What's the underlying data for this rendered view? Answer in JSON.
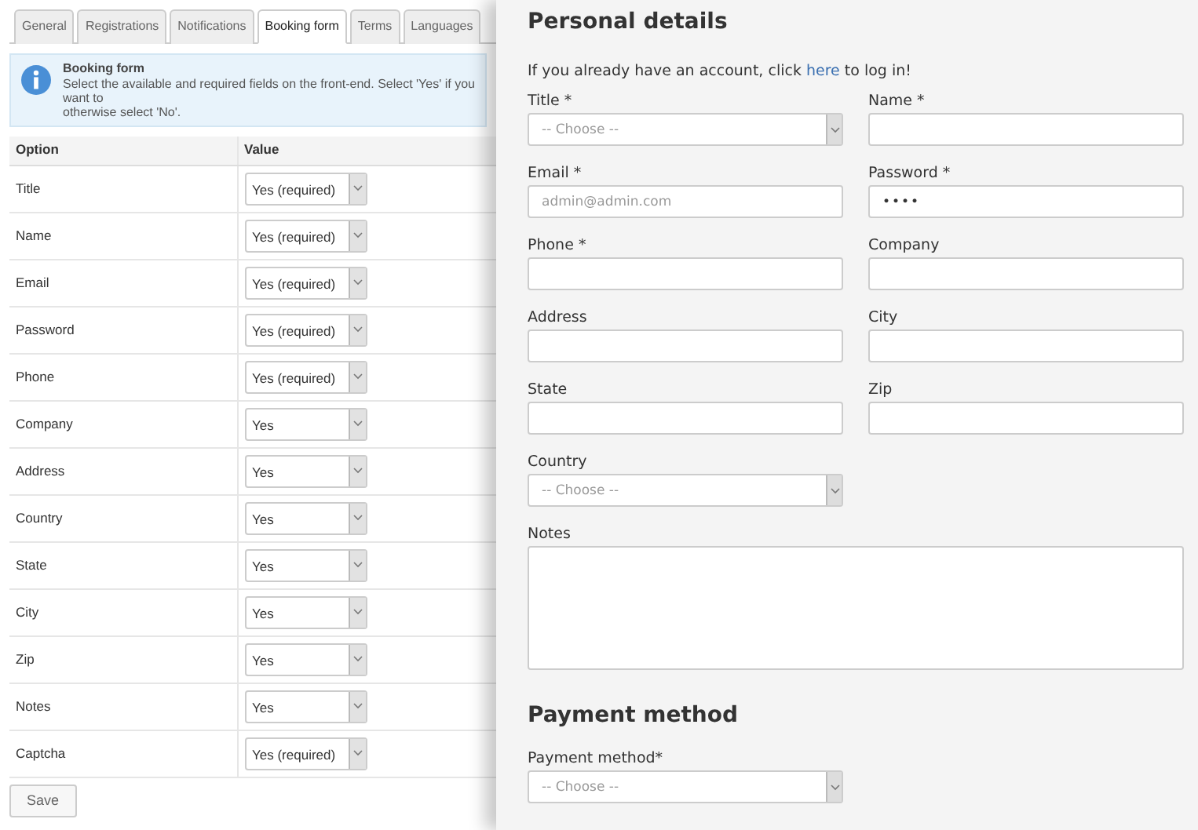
{
  "tabs": [
    {
      "label": "General",
      "selected": false
    },
    {
      "label": "Registrations",
      "selected": false
    },
    {
      "label": "Notifications",
      "selected": false
    },
    {
      "label": "Booking form",
      "selected": true
    },
    {
      "label": "Terms",
      "selected": false
    },
    {
      "label": "Languages",
      "selected": false
    }
  ],
  "info": {
    "title": "Booking form",
    "lines": [
      "Select the available and required fields on the front-end. Select 'Yes' if you want to",
      "otherwise select 'No'."
    ]
  },
  "table": {
    "columns": [
      "Option",
      "Value"
    ],
    "rows": [
      {
        "option": "Title",
        "value": "Yes (required)"
      },
      {
        "option": "Name",
        "value": "Yes (required)"
      },
      {
        "option": "Email",
        "value": "Yes (required)"
      },
      {
        "option": "Password",
        "value": "Yes (required)"
      },
      {
        "option": "Phone",
        "value": "Yes (required)"
      },
      {
        "option": "Company",
        "value": "Yes"
      },
      {
        "option": "Address",
        "value": "Yes"
      },
      {
        "option": "Country",
        "value": "Yes"
      },
      {
        "option": "State",
        "value": "Yes"
      },
      {
        "option": "City",
        "value": "Yes"
      },
      {
        "option": "Zip",
        "value": "Yes"
      },
      {
        "option": "Notes",
        "value": "Yes"
      },
      {
        "option": "Captcha",
        "value": "Yes (required)"
      }
    ]
  },
  "save_button": "Save",
  "form": {
    "heading": "Personal details",
    "intro_before": "If you already have an account, click",
    "intro_link": "here",
    "intro_after": "to log in!",
    "fields": [
      {
        "label": "Title *",
        "kind": "select",
        "placeholder": "-- Choose --"
      },
      {
        "label": "Name *",
        "kind": "input"
      },
      {
        "label": "Email *",
        "kind": "input",
        "placeholder": "admin@admin.com"
      },
      {
        "label": "Password *",
        "kind": "password",
        "value": "••••"
      },
      {
        "label": "Phone *",
        "kind": "input"
      },
      {
        "label": "Company",
        "kind": "input"
      },
      {
        "label": "Address",
        "kind": "input"
      },
      {
        "label": "City",
        "kind": "input"
      },
      {
        "label": "State",
        "kind": "input"
      },
      {
        "label": "Zip",
        "kind": "input"
      },
      {
        "label": "Country",
        "kind": "select",
        "placeholder": "-- Choose --"
      },
      {
        "label": "Notes",
        "kind": "textarea"
      }
    ]
  },
  "payment": {
    "heading": "Payment method",
    "label": "Payment method*",
    "placeholder": "-- Choose --"
  }
}
